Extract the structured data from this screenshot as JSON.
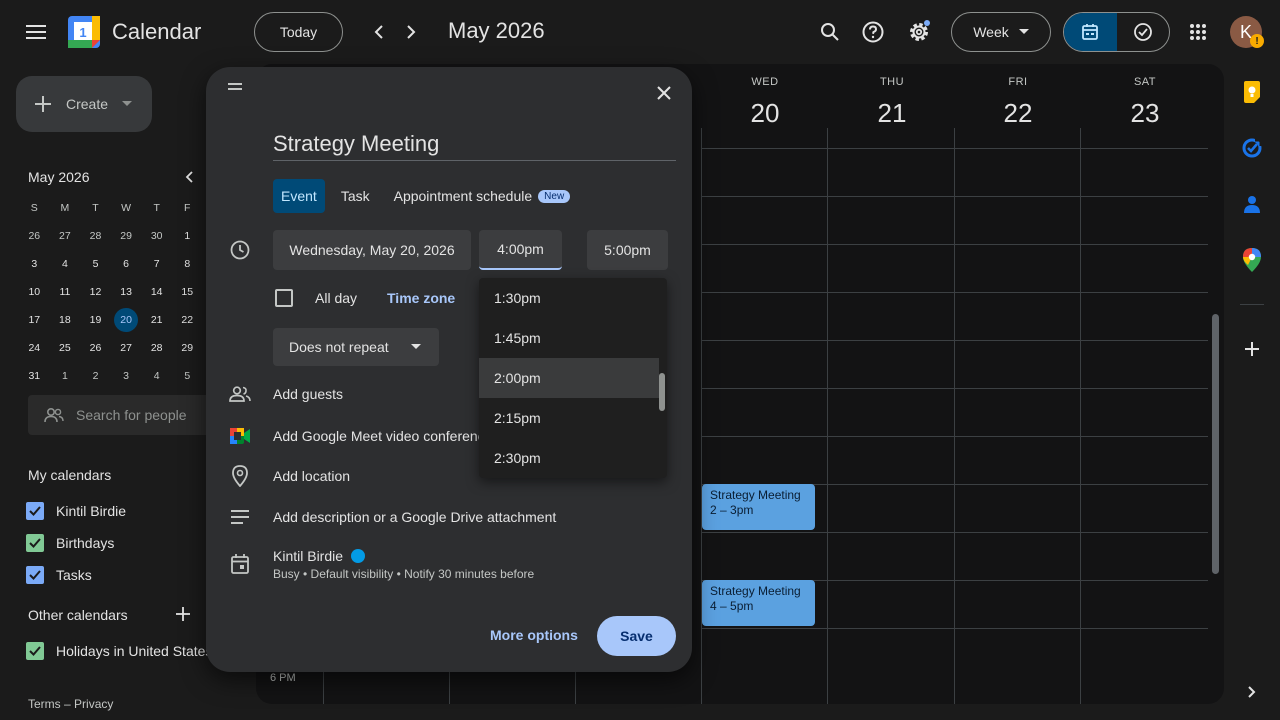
{
  "app": {
    "title": "Calendar",
    "logo_day": "1"
  },
  "header": {
    "today_label": "Today",
    "month_title": "May 2026",
    "view_label": "Week",
    "avatar_letter": "K",
    "avatar_badge": "!"
  },
  "sidebar": {
    "create_label": "Create",
    "mini_month": "May 2026",
    "weekday_headers": [
      "S",
      "M",
      "T",
      "W",
      "T",
      "F"
    ],
    "mini_rows": [
      [
        "26",
        "27",
        "28",
        "29",
        "30",
        "1"
      ],
      [
        "3",
        "4",
        "5",
        "6",
        "7",
        "8"
      ],
      [
        "10",
        "11",
        "12",
        "13",
        "14",
        "15"
      ],
      [
        "17",
        "18",
        "19",
        "20",
        "21",
        "22"
      ],
      [
        "24",
        "25",
        "26",
        "27",
        "28",
        "29"
      ],
      [
        "31",
        "1",
        "2",
        "3",
        "4",
        "5"
      ]
    ],
    "selected_day": "20",
    "search_people_placeholder": "Search for people",
    "my_calendars_title": "My calendars",
    "my_calendars": [
      {
        "name": "Kintil Birdie",
        "color": "#7baaf7"
      },
      {
        "name": "Birthdays",
        "color": "#81c995"
      },
      {
        "name": "Tasks",
        "color": "#7baaf7"
      }
    ],
    "other_calendars_title": "Other calendars",
    "other_calendars": [
      {
        "name": "Holidays in United States",
        "color": "#81c995"
      }
    ],
    "footer_terms": "Terms",
    "footer_sep": "–",
    "footer_privacy": "Privacy"
  },
  "week": {
    "days": [
      {
        "name": "WED",
        "date": "20"
      },
      {
        "name": "THU",
        "date": "21"
      },
      {
        "name": "FRI",
        "date": "22"
      },
      {
        "name": "SAT",
        "date": "23"
      }
    ],
    "time_label": "6 PM",
    "events": [
      {
        "title": "Strategy Meeting",
        "time": "2 – 3pm"
      },
      {
        "title": "Strategy Meeting",
        "time": "4 – 5pm"
      }
    ]
  },
  "dialog": {
    "title_value": "Strategy Meeting",
    "tabs": {
      "event": "Event",
      "task": "Task",
      "appointment": "Appointment schedule",
      "new_badge": "New"
    },
    "date_value": "Wednesday, May 20, 2026",
    "start_time": "4:00pm",
    "end_time": "5:00pm",
    "time_dash": "–",
    "all_day_label": "All day",
    "time_zone_label": "Time zone",
    "repeat_value": "Does not repeat",
    "add_guests": "Add guests",
    "add_meet": "Add Google Meet video conferencing",
    "add_location": "Add location",
    "add_description": "Add description or a Google Drive attachment",
    "owner_name": "Kintil Birdie",
    "owner_details": "Busy • Default visibility • Notify 30 minutes before",
    "more_options": "More options",
    "save": "Save"
  },
  "time_dropdown": {
    "options": [
      "1:30pm",
      "1:45pm",
      "2:00pm",
      "2:15pm",
      "2:30pm"
    ],
    "highlighted": "2:00pm"
  }
}
